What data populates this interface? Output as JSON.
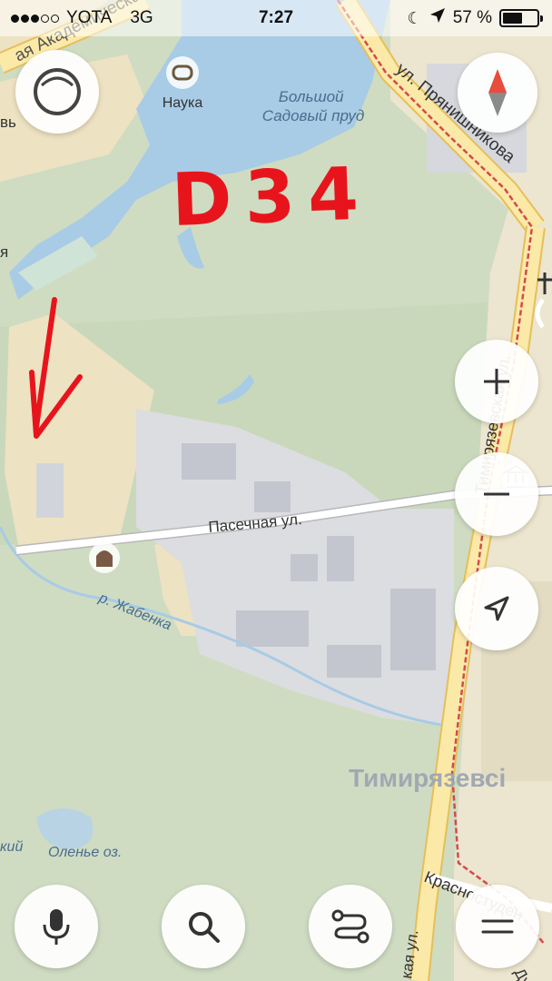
{
  "status_bar": {
    "carrier": "YOTA",
    "network": "3G",
    "time": "7:27",
    "battery_percent_label": "57 %",
    "battery_level": 0.57,
    "signal_bars_filled": 3,
    "signal_bars_total": 5
  },
  "map": {
    "labels": {
      "street_akademicheskaya": "ая Академическая",
      "poi_nauka": "Наука",
      "pond_name": "Большой\nСадовый пруд",
      "street_pryanishnikova": "ул. Прянишникова",
      "street_pasechnaya": "Пасечная ул.",
      "river_zhabenka": "р. Жабенка",
      "street_timiryazevskaya": "Тимирязевская ул.",
      "district_timiryazevsky": "Тимирязевсі",
      "lake_olenye": "Оленье оз.",
      "partial_left_kiy": "кий",
      "street_krasnostudencheskiy": "Красностуден",
      "partial_bottom_kaya": "кая ул.",
      "partial_dubki": "Дубк",
      "partial_left_v": "вь",
      "partial_left_ya": "я"
    },
    "annotation": {
      "text": "D34",
      "color": "#e8141c"
    },
    "colors": {
      "park": "#cfdcc2",
      "water": "#a8cbe6",
      "sand": "#ede2c2",
      "industrial": "#dcdde0",
      "building": "#c3c6cf",
      "road": "#fbe9a8",
      "road_edge": "#e5bf5a",
      "railway": "#d44a4a"
    }
  },
  "controls": {
    "layers_icon": "layers-icon",
    "compass_icon": "compass-icon",
    "zoom_in_icon": "plus-icon",
    "zoom_out_icon": "minus-icon",
    "location_icon": "navigation-arrow-icon",
    "voice_icon": "microphone-icon",
    "search_icon": "search-icon",
    "routes_icon": "route-icon",
    "menu_icon": "menu-icon"
  }
}
